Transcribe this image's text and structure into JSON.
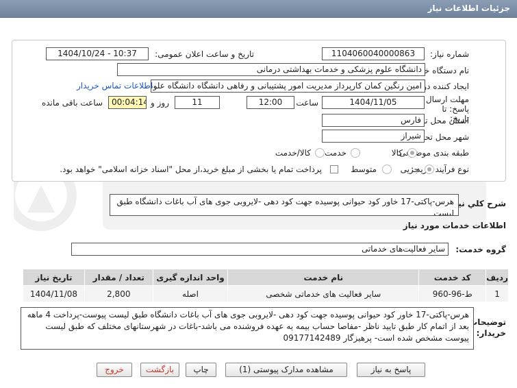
{
  "header": {
    "title": "جزئیات اطلاعات نیاز"
  },
  "form": {
    "need_number_label": "شماره نیاز:",
    "need_number": "1104060040000863",
    "announce_label": "تاریخ و ساعت اعلان عمومی:",
    "announce_value": "1404/10/24 - 10:37",
    "buyer_org_label": "نام دستگاه خریدار:",
    "buyer_org": "دانشگاه علوم پزشکی و خدمات بهداشتی درمانی",
    "creator_label": "ایجاد کننده درخواست:",
    "creator": "امین رنگین کمان کارپرداز مدیریت امور پشتیبانی و رفاهی دانشگاه دانشگاه علوم",
    "contact_link": "اطلاعات تماس خریدار",
    "deadline_label": "مهلت ارسال پاسخ: تا تاریخ:",
    "deadline_date": "1404/11/05",
    "time_label": "ساعت",
    "deadline_time": "12:00",
    "days_value": "11",
    "days_label": "روز و",
    "remaining_time": "00:04:14",
    "remaining_label": "ساعت باقی مانده",
    "province_label": "استان محل تحویل:",
    "province": "فارس",
    "city_label": "شهر محل تحویل:",
    "city": "شیراز",
    "category_label": "طبقه بندی موضوعی:",
    "category_options": [
      "کالا",
      "خدمت",
      "کالا/خدمت"
    ],
    "process_label": "نوع فرآیند خرید :",
    "process_options": [
      "جزیی",
      "متوسط"
    ],
    "payment_note": "پرداخت تمام یا بخشی از مبلغ خرید،از محل \"اسناد خزانه اسلامی\" خواهد بود."
  },
  "summary": {
    "label": "شرح کلي نياز:",
    "value": "هرس-پاکتی-17 خاور کود حیوانی پوسیده جهت کود دهی -لایروبی جوی های آب باغات دانشگاه طبق لیست"
  },
  "services": {
    "section_title": "اطلاعات خدمات مورد نیاز",
    "group_label": "گروه خدمت:",
    "group_value": "سایر فعالیت‌های خدماتی",
    "columns": [
      "ردیف",
      "کد خدمت",
      "نام خدمت",
      "واحد اندازه گیری",
      "تعداد / مقدار",
      "تاریخ نیاز"
    ],
    "rows": [
      [
        "1",
        "ط-96-960",
        "سایر فعالیت های خدماتی شخصی",
        "اصله",
        "2,800",
        "1404/11/08"
      ]
    ]
  },
  "buyer_notes": {
    "label": "توضیحات خریدار:",
    "value": "هرس-پاکتی-17 خاور کود حیوانی پوسیده جهت کود دهی -لایروبی جوی های آب باغات دانشگاه طبق لیست پیوست-پرداخت 4 ماهه بعد از اتمام کار طبق تایید ناظر -مفاصا حساب بیمه به عهده فروشنده می باشد-باغات در شهرستانهای مختلف که طبق لیست پیوست مشخص شده است- پرهیزگار 09177142489"
  },
  "buttons": {
    "reply": "پاسخ به نیاز",
    "docs": "مشاهده مدارک پیوستی (1)",
    "print": "چاپ",
    "back": "بازگشت",
    "exit": "خروج"
  },
  "colors": {
    "header_bg": "#7d91a8",
    "timer_bg": "#fff7b3",
    "link": "#1a57c7",
    "watermark": "#e6e6e6"
  }
}
